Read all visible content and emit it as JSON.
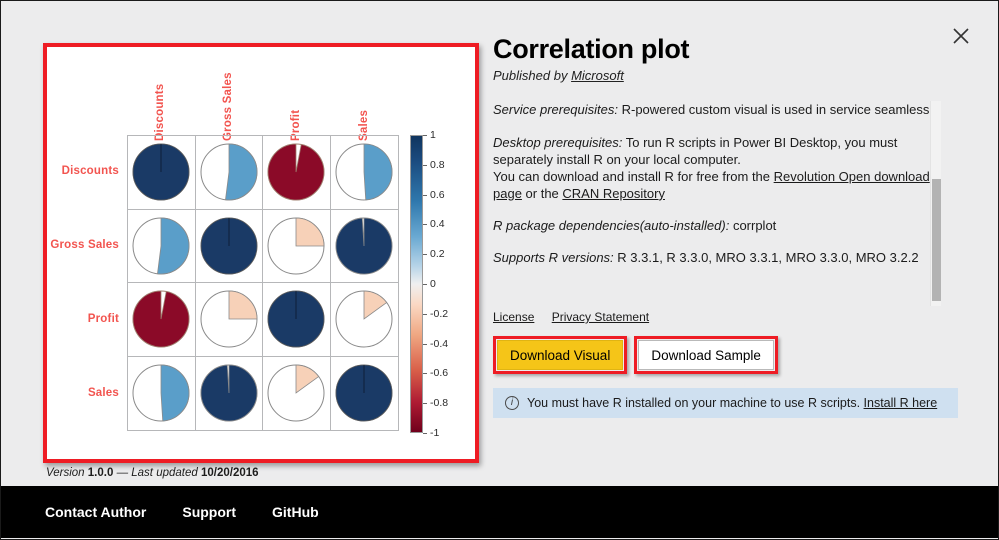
{
  "window": {
    "close_icon": "close-icon"
  },
  "detail": {
    "title": "Correlation plot",
    "published_prefix": "Published by",
    "publisher": "Microsoft",
    "paragraphs": [
      {
        "label": "Service prerequisites:",
        "text": " R-powered custom visual is used in service seamlessly"
      },
      {
        "label": "Desktop prerequisites:",
        "text": " To run R scripts in Power BI Desktop, you must separately install R on your local computer."
      },
      {
        "label": "",
        "text": "You can download and install R for free from the "
      },
      {
        "label": "R package dependencies(auto-installed):",
        "text": " corrplot"
      },
      {
        "label": "Supports R versions:",
        "text": " R 3.3.1, R 3.3.0, MRO 3.3.1, MRO 3.3.0, MRO 3.2.2"
      }
    ],
    "download_link_1": "Revolution Open download page",
    "download_mid": " or the ",
    "download_link_2": "CRAN Repository",
    "legal": {
      "license": "License",
      "privacy": "Privacy Statement"
    },
    "buttons": {
      "download_visual": "Download Visual",
      "download_sample": "Download Sample"
    },
    "notice": {
      "icon": "info-icon",
      "text": "You must have R installed on your machine to use R scripts.",
      "link": "Install R here"
    }
  },
  "version": {
    "prefix": "Version",
    "number": "1.0.0",
    "separator": "—",
    "updated_label": "Last updated",
    "updated_date": "10/20/2016"
  },
  "footer": {
    "links": [
      {
        "label": "Contact Author"
      },
      {
        "label": "Support"
      },
      {
        "label": "GitHub"
      }
    ]
  },
  "colors": {
    "highlight_red": "#ee1c24",
    "button_yellow": "#f5c518",
    "notice_blue": "#cfe0f0",
    "label_red": "#f2544f",
    "pie_dark_blue": "#1a3a66",
    "pie_light_blue": "#5a9ec9",
    "pie_dark_red": "#8b0a28",
    "pie_peach": "#f7d1b8",
    "pie_empty": "#ffffff"
  },
  "chart_data": {
    "type": "heatmap",
    "title": "Correlation plot",
    "variant": "corrplot-pie",
    "categories": [
      "Discounts",
      "Gross Sales",
      "Profit",
      "Sales"
    ],
    "xlabel": "",
    "ylabel": "",
    "grid": true,
    "legend": {
      "position": "right",
      "range": [
        -1,
        1
      ],
      "ticks": [
        1,
        0.8,
        0.6,
        0.4,
        0.2,
        0,
        -0.2,
        -0.4,
        -0.6,
        -0.8,
        -1
      ],
      "tick_labels": [
        "1",
        "0.8",
        "0.6",
        "0.4",
        "0.2",
        "0",
        "-0.2",
        "-0.4",
        "-0.6",
        "-0.8",
        "-1"
      ],
      "colorscale": "RdBu"
    },
    "matrix": [
      [
        1.0,
        0.52,
        -0.97,
        0.49
      ],
      [
        0.52,
        1.0,
        0.25,
        0.99
      ],
      [
        -0.97,
        0.25,
        1.0,
        0.15
      ],
      [
        0.49,
        0.99,
        0.15,
        1.0
      ]
    ],
    "cells": [
      {
        "row": "Discounts",
        "col": "Discounts",
        "value": 1.0,
        "color": "#1a3a66"
      },
      {
        "row": "Discounts",
        "col": "Gross Sales",
        "value": 0.52,
        "color": "#5a9ec9"
      },
      {
        "row": "Discounts",
        "col": "Profit",
        "value": -0.97,
        "color": "#8b0a28"
      },
      {
        "row": "Discounts",
        "col": "Sales",
        "value": 0.49,
        "color": "#5a9ec9"
      },
      {
        "row": "Gross Sales",
        "col": "Discounts",
        "value": 0.52,
        "color": "#5a9ec9"
      },
      {
        "row": "Gross Sales",
        "col": "Gross Sales",
        "value": 1.0,
        "color": "#1a3a66"
      },
      {
        "row": "Gross Sales",
        "col": "Profit",
        "value": 0.25,
        "color": "#f7d1b8"
      },
      {
        "row": "Gross Sales",
        "col": "Sales",
        "value": 0.99,
        "color": "#1a3a66"
      },
      {
        "row": "Profit",
        "col": "Discounts",
        "value": -0.97,
        "color": "#8b0a28"
      },
      {
        "row": "Profit",
        "col": "Gross Sales",
        "value": 0.25,
        "color": "#f7d1b8"
      },
      {
        "row": "Profit",
        "col": "Profit",
        "value": 1.0,
        "color": "#1a3a66"
      },
      {
        "row": "Profit",
        "col": "Sales",
        "value": 0.15,
        "color": "#f7d1b8"
      },
      {
        "row": "Sales",
        "col": "Discounts",
        "value": 0.49,
        "color": "#5a9ec9"
      },
      {
        "row": "Sales",
        "col": "Gross Sales",
        "value": 0.99,
        "color": "#1a3a66"
      },
      {
        "row": "Sales",
        "col": "Profit",
        "value": 0.15,
        "color": "#f7d1b8"
      },
      {
        "row": "Sales",
        "col": "Sales",
        "value": 1.0,
        "color": "#1a3a66"
      }
    ]
  }
}
